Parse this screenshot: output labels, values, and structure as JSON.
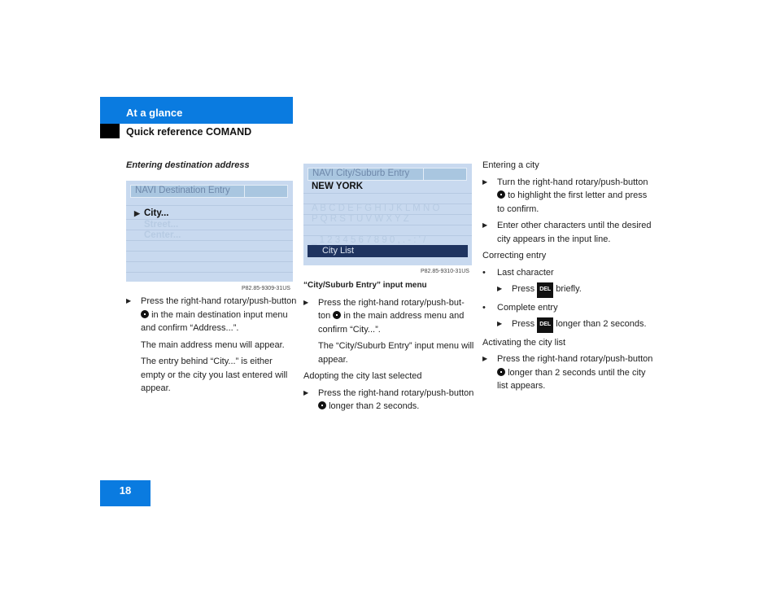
{
  "header": {
    "section": "At a glance",
    "subsection": "Quick reference COMAND",
    "page_number": "18"
  },
  "left": {
    "heading": "Entering destination address",
    "screen": {
      "title": "NAVI Destination Entry",
      "items": [
        "City...",
        "Street...",
        "Center..."
      ],
      "selected": "City...",
      "caption": "P82.85-9309-31US"
    },
    "step": {
      "before": "Press the right-hand rotary/push-button",
      "after": "in the main destination input menu and confirm “Address...”."
    },
    "notes": [
      "The main address menu will appear.",
      "The entry behind “City...” is either empty or the city you last entered will appear."
    ]
  },
  "middle": {
    "screen": {
      "title": "NAVI City/Suburb Entry",
      "value": "NEW YORK",
      "row1": "A B C D E F G H I J K L M N O",
      "row2": "P Q R S T U V W X Y Z",
      "row3": "_ 1 2 3 4 5 6 7 8 9 0 , . - : ' /",
      "button": "City List",
      "caption": "P82.85-9310-31US"
    },
    "caption_title": "“City/Suburb Entry” input menu",
    "step1": {
      "before": "Press the right-hand rotary/push-but-ton",
      "after": "in the main address menu and confirm “City...”."
    },
    "note": "The “City/Suburb Entry” input menu will appear.",
    "heading2": "Adopting the city last selected",
    "step2": {
      "before": "Press the right-hand rotary/push-button",
      "after": "longer than 2 seconds."
    }
  },
  "right": {
    "heading1": "Entering a city",
    "step1": {
      "before": "Turn the right-hand rotary/push-button",
      "after": "to highlight the first letter and press to confirm."
    },
    "step2": "Enter other characters until the desired city appears in the input line.",
    "heading2": "Correcting entry",
    "bullet1": "Last character",
    "sub1": {
      "before": "Press",
      "key": "DEL",
      "after": "briefly."
    },
    "bullet2": "Complete entry",
    "sub2": {
      "before": "Press",
      "key": "DEL",
      "after": "longer than 2 seconds."
    },
    "heading3": "Activating the city list",
    "step3": {
      "before": "Press the right-hand rotary/push-button",
      "after": "longer than 2 seconds until the city list appears."
    }
  }
}
